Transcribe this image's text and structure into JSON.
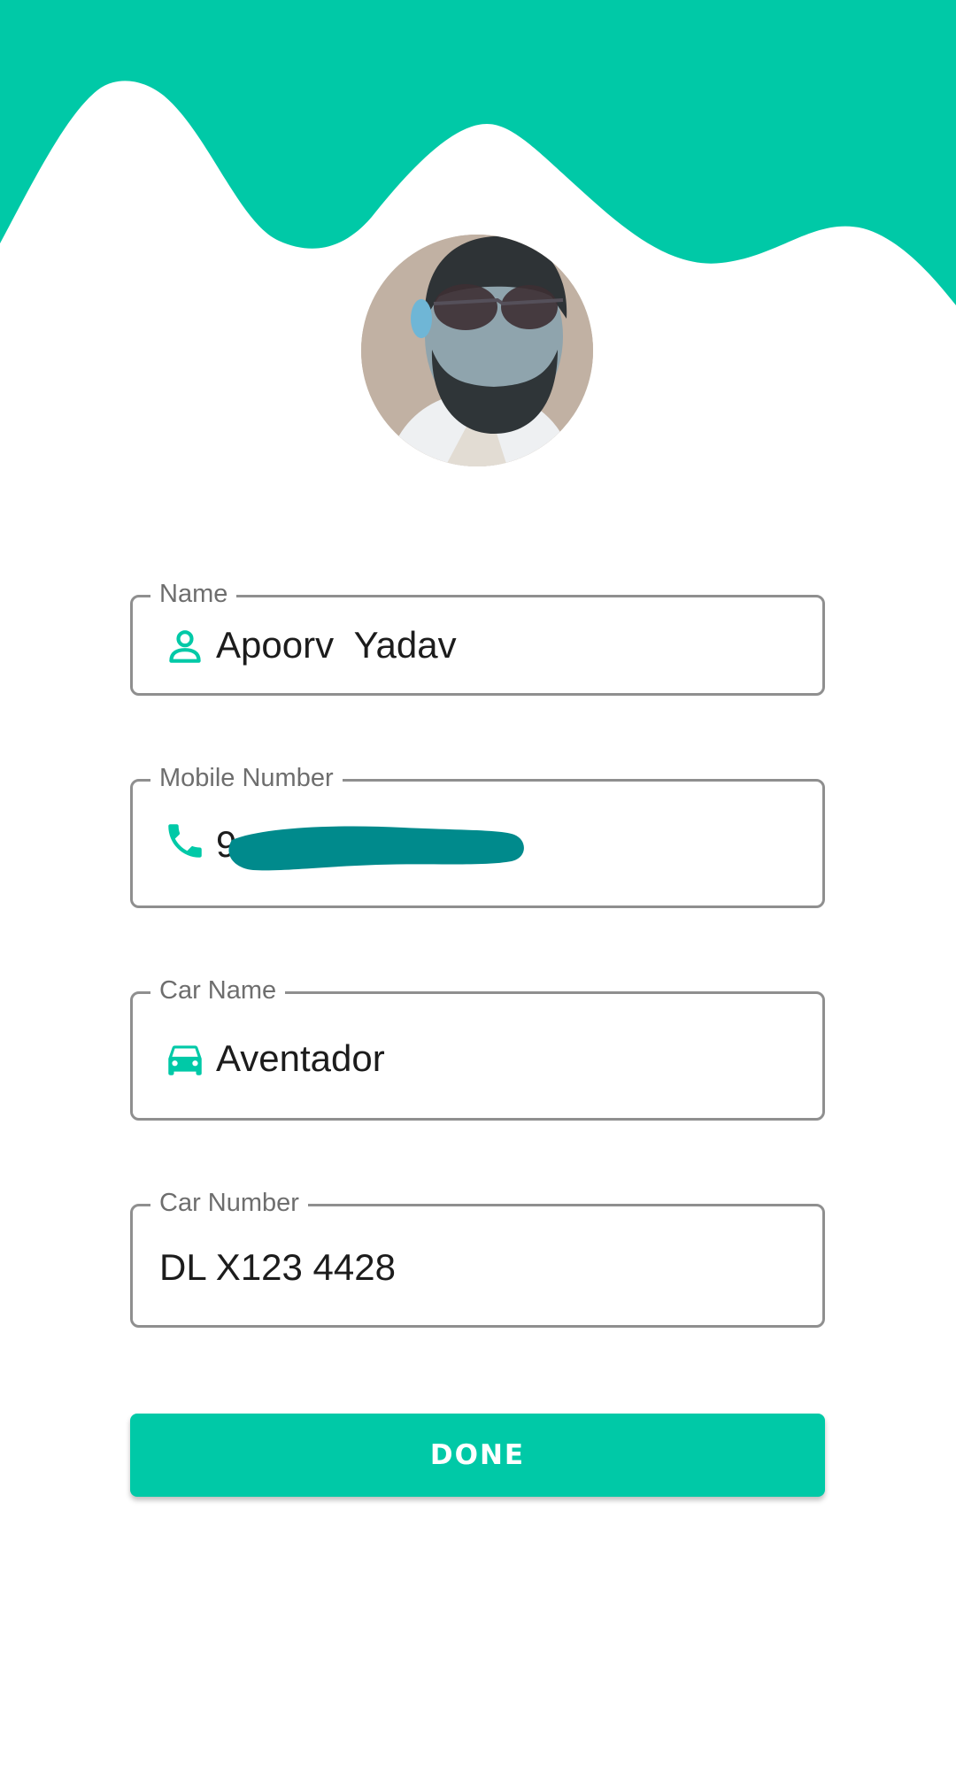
{
  "colors": {
    "accent": "#00c9a7",
    "field_border": "#8f8f8f",
    "label_text": "#6e6e6e",
    "value_text": "#1c1c1c",
    "redaction": "#008a8c"
  },
  "profile": {
    "avatar_icon": "profile-photo"
  },
  "form": {
    "name": {
      "label": "Name",
      "value": "Apoorv  Yadav",
      "icon": "person-icon"
    },
    "mobile": {
      "label": "Mobile Number",
      "value": "9",
      "icon": "phone-icon"
    },
    "car_name": {
      "label": "Car Name",
      "value": "Aventador",
      "icon": "car-icon"
    },
    "car_number": {
      "label": "Car Number",
      "value": "DL X123 4428"
    }
  },
  "actions": {
    "done_label": "DONE"
  }
}
